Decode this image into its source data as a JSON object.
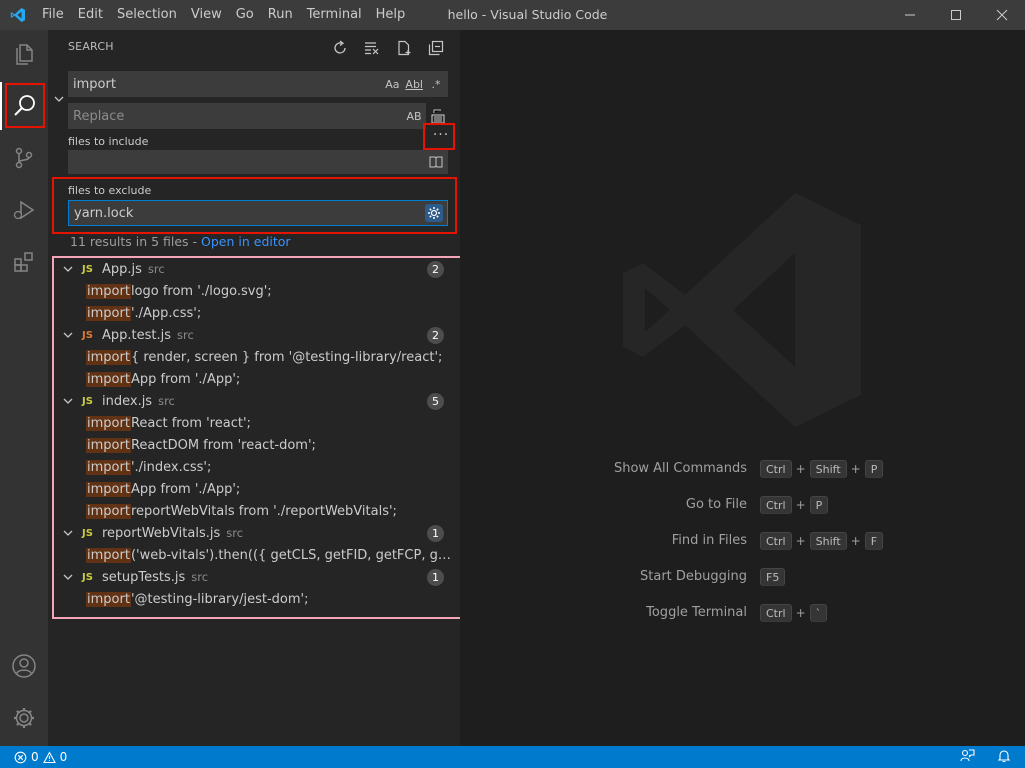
{
  "titlebar": {
    "title": "hello - Visual Studio Code",
    "menu": [
      "File",
      "Edit",
      "Selection",
      "View",
      "Go",
      "Run",
      "Terminal",
      "Help"
    ]
  },
  "activity": {
    "items": [
      "explorer-icon",
      "search-icon",
      "source-control-icon",
      "run-debug-icon",
      "extensions-icon"
    ],
    "bottom": [
      "accounts-icon",
      "manage-gear-icon"
    ]
  },
  "sidebar": {
    "header": "SEARCH",
    "actions": [
      "refresh-icon",
      "clear-results-icon",
      "new-search-editor-icon",
      "collapse-all-icon"
    ],
    "search_value": "import",
    "search_options": [
      "Aa",
      "Abl",
      ".*"
    ],
    "replace_placeholder": "Replace",
    "replace_option": "AB",
    "files_to_include_label": "files to include",
    "files_to_include_value": "",
    "files_to_exclude_label": "files to exclude",
    "files_to_exclude_value": "yarn.lock",
    "results_summary": "11 results in 5 files - ",
    "open_in_editor": "Open in editor"
  },
  "results": [
    {
      "icon": "JS",
      "name": "App.js",
      "dir": "src",
      "count": "2",
      "matches": [
        {
          "hl": "import",
          "rest": " logo from './logo.svg';"
        },
        {
          "hl": "import",
          "rest": " './App.css';"
        }
      ]
    },
    {
      "icon": "JS",
      "name": "App.test.js",
      "dir": "src",
      "count": "2",
      "matches": [
        {
          "hl": "import",
          "rest": " { render, screen } from '@testing-library/react';"
        },
        {
          "hl": "import",
          "rest": " App from './App';"
        }
      ]
    },
    {
      "icon": "JS",
      "name": "index.js",
      "dir": "src",
      "count": "5",
      "matches": [
        {
          "hl": "import",
          "rest": " React from 'react';"
        },
        {
          "hl": "import",
          "rest": " ReactDOM from 'react-dom';"
        },
        {
          "hl": "import",
          "rest": " './index.css';"
        },
        {
          "hl": "import",
          "rest": " App from './App';"
        },
        {
          "hl": "import",
          "rest": " reportWebVitals from './reportWebVitals';"
        }
      ]
    },
    {
      "icon": "JS",
      "name": "reportWebVitals.js",
      "dir": "src",
      "count": "1",
      "matches": [
        {
          "hl": "import",
          "rest": "('web-vitals').then(({ getCLS, getFID, getFCP, getLCP, getT..."
        }
      ]
    },
    {
      "icon": "JS",
      "name": "setupTests.js",
      "dir": "src",
      "count": "1",
      "matches": [
        {
          "hl": "import",
          "rest": " '@testing-library/jest-dom';"
        }
      ]
    }
  ],
  "editor": {
    "shortcuts": [
      {
        "label": "Show All Commands",
        "keys": [
          "Ctrl",
          "Shift",
          "P"
        ]
      },
      {
        "label": "Go to File",
        "keys": [
          "Ctrl",
          "P"
        ]
      },
      {
        "label": "Find in Files",
        "keys": [
          "Ctrl",
          "Shift",
          "F"
        ]
      },
      {
        "label": "Start Debugging",
        "keys": [
          "F5"
        ]
      },
      {
        "label": "Toggle Terminal",
        "keys": [
          "Ctrl",
          "`"
        ]
      }
    ]
  },
  "statusbar": {
    "errors": "0",
    "warnings": "0"
  },
  "colors": {
    "accent": "#007acc",
    "highlight": "#613214",
    "annotation_red": "#e51400",
    "annotation_pink": "#f4a6b8"
  }
}
